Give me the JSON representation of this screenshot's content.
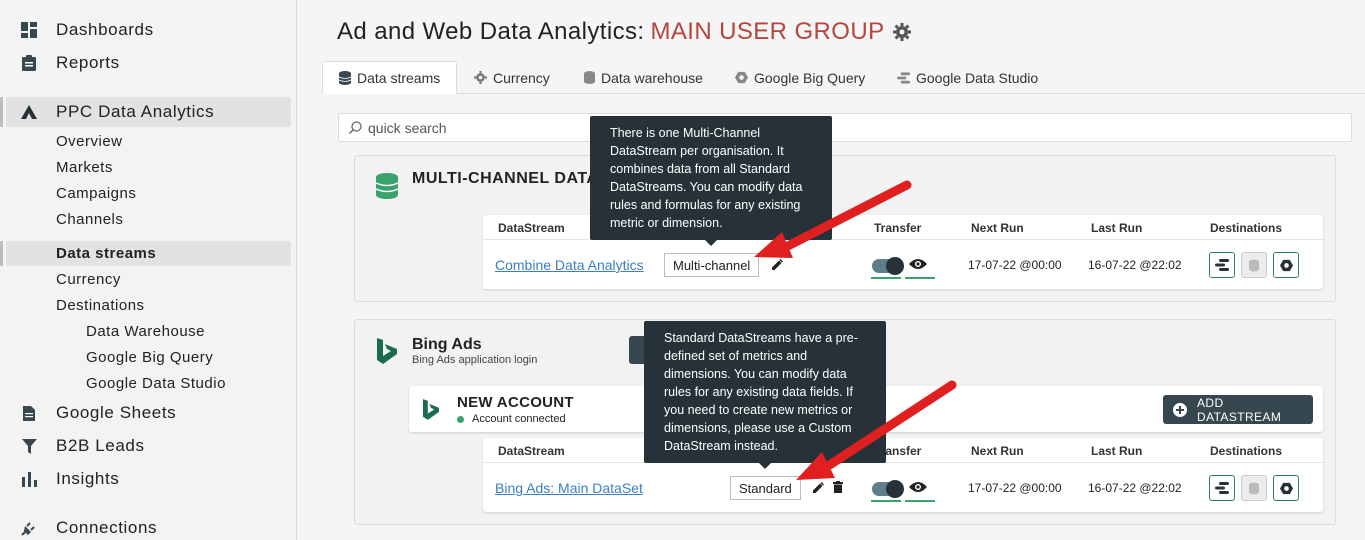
{
  "sidebar": {
    "top": [
      {
        "label": "Dashboards",
        "icon": "dashboard-icon"
      },
      {
        "label": "Reports",
        "icon": "report-icon"
      }
    ],
    "ppc": {
      "label": "PPC Data Analytics",
      "icon": "ppc-icon"
    },
    "ppc_sub": [
      "Overview",
      "Markets",
      "Campaigns",
      "Channels"
    ],
    "data_sub": [
      "Data streams",
      "Currency",
      "Destinations"
    ],
    "destinations_sub": [
      "Data Warehouse",
      "Google Big Query",
      "Google Data Studio"
    ],
    "bottom": [
      {
        "label": "Google Sheets",
        "icon": "sheet-icon"
      },
      {
        "label": "B2B Leads",
        "icon": "funnel-icon"
      },
      {
        "label": "Insights",
        "icon": "bar-chart-icon"
      },
      {
        "label": "Connections",
        "icon": "plug-icon"
      }
    ]
  },
  "header": {
    "title": "Ad and Web Data Analytics:",
    "group": "MAIN USER GROUP"
  },
  "tabs": [
    "Data streams",
    "Currency",
    "Data warehouse",
    "Google Big Query",
    "Google Data Studio"
  ],
  "search": {
    "placeholder": "quick search"
  },
  "multichannel": {
    "title": "MULTI-CHANNEL DATA",
    "headers": {
      "datastream": "DataStream",
      "transfer": "Transfer",
      "next_run": "Next Run",
      "last_run": "Last Run",
      "destinations": "Destinations"
    },
    "row": {
      "name": "Combine Data Analytics",
      "type": "Multi-channel",
      "next_run": "17-07-22 @00:00",
      "last_run": "16-07-22 @22:02"
    },
    "tooltip": "There is one Multi-Channel DataStream per organisation. It combines data from all Standard DataStreams. You can modify data rules and formulas for any existing metric or dimension."
  },
  "bing": {
    "title": "Bing Ads",
    "subtitle": "Bing Ads application login",
    "account": {
      "name": "NEW ACCOUNT",
      "status": "Account connected"
    },
    "add_button": "ADD DATASTREAM",
    "headers": {
      "datastream": "DataStream",
      "transfer": "Transfer",
      "next_run": "Next Run",
      "last_run": "Last Run",
      "destinations": "Destinations"
    },
    "row": {
      "name": "Bing Ads: Main DataSet",
      "type": "Standard",
      "next_run": "17-07-22 @00:00",
      "last_run": "16-07-22 @22:02"
    },
    "tooltip": "Standard DataStreams have a pre-defined set of metrics and dimensions. You can modify data rules for any existing data fields. If you need to create new metrics or dimensions, please use a Custom DataStream instead."
  },
  "colors": {
    "accent_red": "#b5453d",
    "link": "#3b7ec4",
    "green": "#3aa36b",
    "tooltip_bg": "#263238",
    "arrow": "#e02020"
  }
}
